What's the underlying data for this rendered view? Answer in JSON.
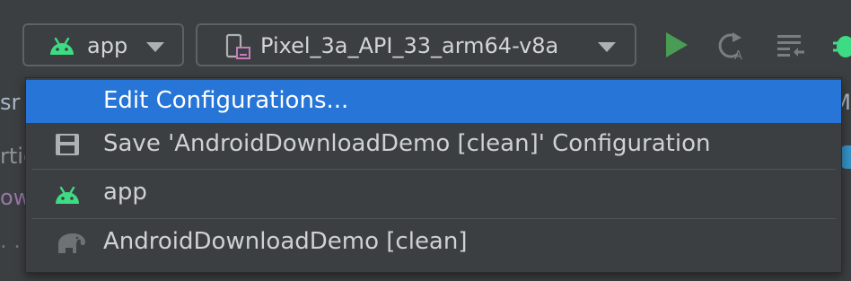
{
  "toolbar": {
    "run_config": {
      "label": "app",
      "icon": "android-icon"
    },
    "device": {
      "label": "Pixel_3a_API_33_arm64-v8a",
      "icon": "phone-device-icon"
    },
    "buttons": [
      {
        "name": "run-button",
        "icon": "play-icon",
        "color": "#499c54"
      },
      {
        "name": "apply-changes-button",
        "icon": "apply-changes-icon"
      },
      {
        "name": "apply-code-changes-button",
        "icon": "apply-code-changes-icon"
      },
      {
        "name": "debug-button",
        "icon": "debug-bug-icon",
        "color": "#3ddc84"
      }
    ]
  },
  "menu": {
    "items": [
      {
        "label": "Edit Configurations...",
        "selected": true
      },
      {
        "label": "Save 'AndroidDownloadDemo [clean]' Configuration",
        "icon": "save-floppy-icon"
      },
      {
        "label": "app",
        "icon": "android-icon"
      },
      {
        "label": "AndroidDownloadDemo [clean]",
        "icon": "gradle-elephant-icon"
      }
    ]
  },
  "background": {
    "row1_left": "sr",
    "row1_right": "M",
    "row2_left": "rtie",
    "row3_left": "ow",
    "row4_left": ". ."
  },
  "colors": {
    "selection": "#2675d7",
    "android_green": "#3ddc84",
    "run_green": "#499c54"
  }
}
